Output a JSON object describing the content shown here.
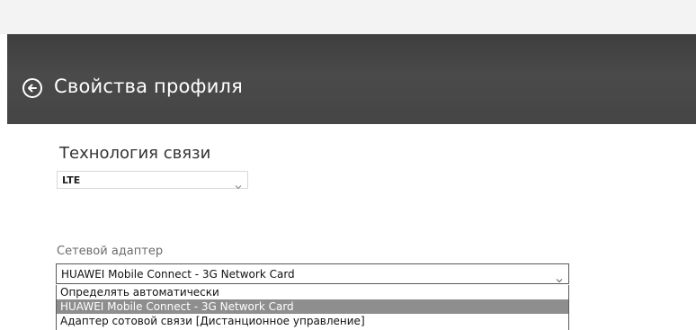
{
  "header": {
    "title": "Свойства профиля",
    "back_icon": "back-arrow-icon"
  },
  "technology": {
    "label": "Технология связи",
    "value": "LTE"
  },
  "adapter": {
    "label": "Сетевой адаптер",
    "value": "HUAWEI Mobile Connect - 3G Network Card",
    "options": [
      "Определять автоматически",
      "HUAWEI Mobile Connect - 3G Network Card",
      "Адаптер сотовой связи [Дистанционное управление]"
    ],
    "selected_index": 1
  },
  "colors": {
    "header_bg": "#454545",
    "selected_option_bg": "#8e8e8e"
  }
}
